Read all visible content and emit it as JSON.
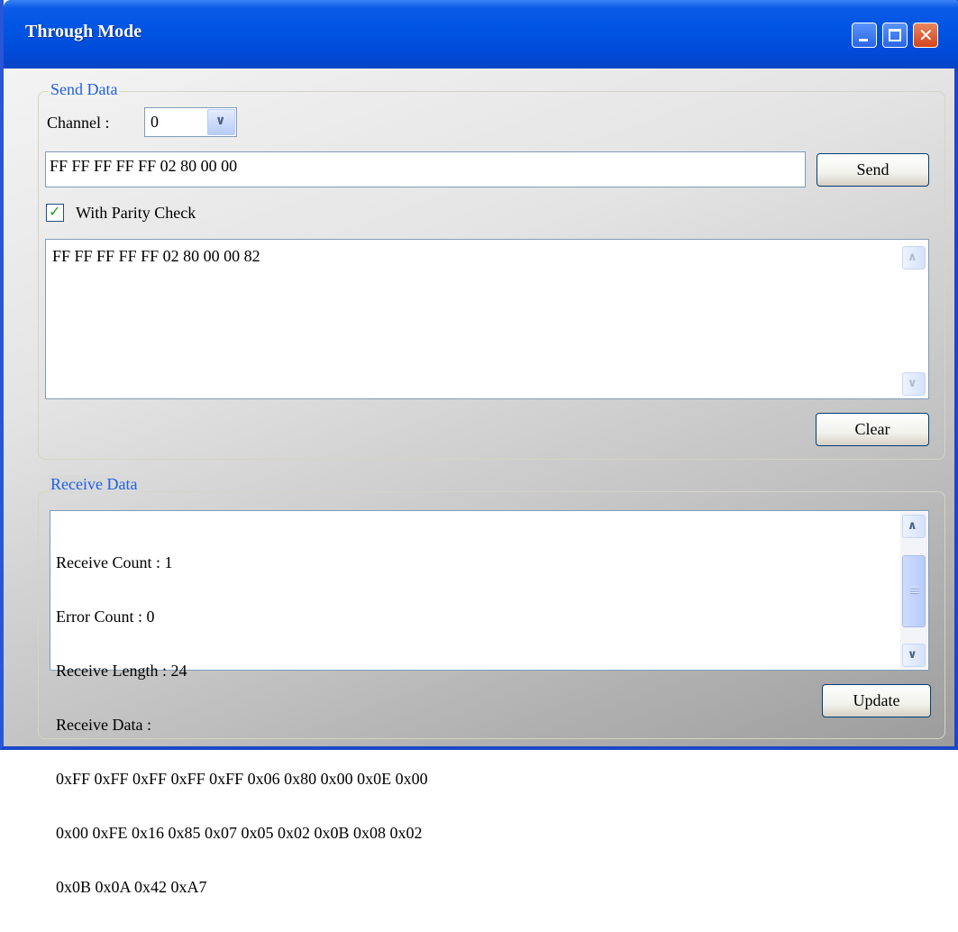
{
  "window": {
    "title": "Through Mode"
  },
  "send": {
    "group_label": "Send Data",
    "channel_label": "Channel :",
    "channel_value": "0",
    "input_value": "FF FF FF FF FF 02 80 00 00",
    "send_label": "Send",
    "parity_label": "With Parity Check",
    "parity_checked": true,
    "output_text": "FF FF FF FF FF 02 80 00 00 82",
    "clear_label": "Clear"
  },
  "receive": {
    "group_label": "Receive Data",
    "lines": [
      "Receive Count : 1",
      "Error Count : 0",
      "Receive Length : 24",
      "Receive Data :",
      "0xFF 0xFF 0xFF 0xFF 0xFF 0x06 0x80 0x00 0x0E 0x00",
      "0x00 0xFE 0x16 0x85 0x07 0x05 0x02 0x0B 0x08 0x02",
      "0x0B 0x0A 0x42 0xA7"
    ],
    "update_label": "Update"
  },
  "icons": {
    "minimize": "minimize-icon",
    "maximize": "maximize-icon",
    "close": "close-icon",
    "dropdown": "chevron-down-icon",
    "check": "checkmark-icon",
    "scroll_up": "chevron-up-icon",
    "scroll_down": "chevron-down-icon"
  },
  "colors": {
    "titlebar": "#0054e3",
    "group_label": "#1e5fe0",
    "close_button": "#d4431c"
  }
}
